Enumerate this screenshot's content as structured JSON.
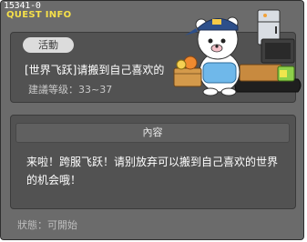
{
  "window": {
    "id": "15341-0",
    "title": "QUEST INFO"
  },
  "quest": {
    "category": "活動",
    "name": "[世界飞跃]请搬到自己喜欢的",
    "level": "建議等级：33~37"
  },
  "content": {
    "header": "內容",
    "body": "来啦！跨服飞跃！请别放弃可以搬到自己喜欢的世界的机会哦！"
  },
  "status": "狀態：可開始",
  "colors": {
    "title": "#f5e04a",
    "window_bg": "#6b6b6b",
    "panel_bg": "#525252"
  },
  "icons": [
    "mover-bear-illustration"
  ]
}
